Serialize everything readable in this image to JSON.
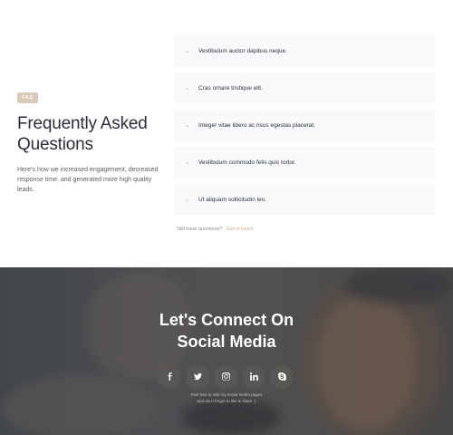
{
  "faq": {
    "tag": "FAQ",
    "title_line1": "Frequently Asked",
    "title_line2": "Questions",
    "description": "Here's how we increased engagement, decreased response time, and generated more high quality leads.",
    "items": [
      {
        "question": "Vestibulum auctor dapibus neque."
      },
      {
        "question": "Cras ornare tristique elit."
      },
      {
        "question": "Integer vitae libero ac risus egestas placerat."
      },
      {
        "question": "Vestibulum commodo felis quis tortor."
      },
      {
        "question": "Ut aliquam sollicitudin leo."
      }
    ],
    "more_text": "Still have questions?",
    "more_link": "Get in touch"
  },
  "social": {
    "title_line1": "Let's Connect On",
    "title_line2": "Social Media",
    "icons": [
      {
        "name": "facebook-icon",
        "glyph": "f"
      },
      {
        "name": "twitter-icon",
        "glyph": "t"
      },
      {
        "name": "instagram-icon",
        "glyph": "i"
      },
      {
        "name": "linkedin-icon",
        "glyph": "in"
      },
      {
        "name": "skype-icon",
        "glyph": "s"
      }
    ],
    "note_line1": "Feel free to visit my social media pages",
    "note_line2": "and don't forget to like & share :)"
  },
  "colors": {
    "accent": "#c7a97e",
    "tag_bg": "#d9cbb8",
    "faq_item_bg": "#f7f9fb"
  }
}
